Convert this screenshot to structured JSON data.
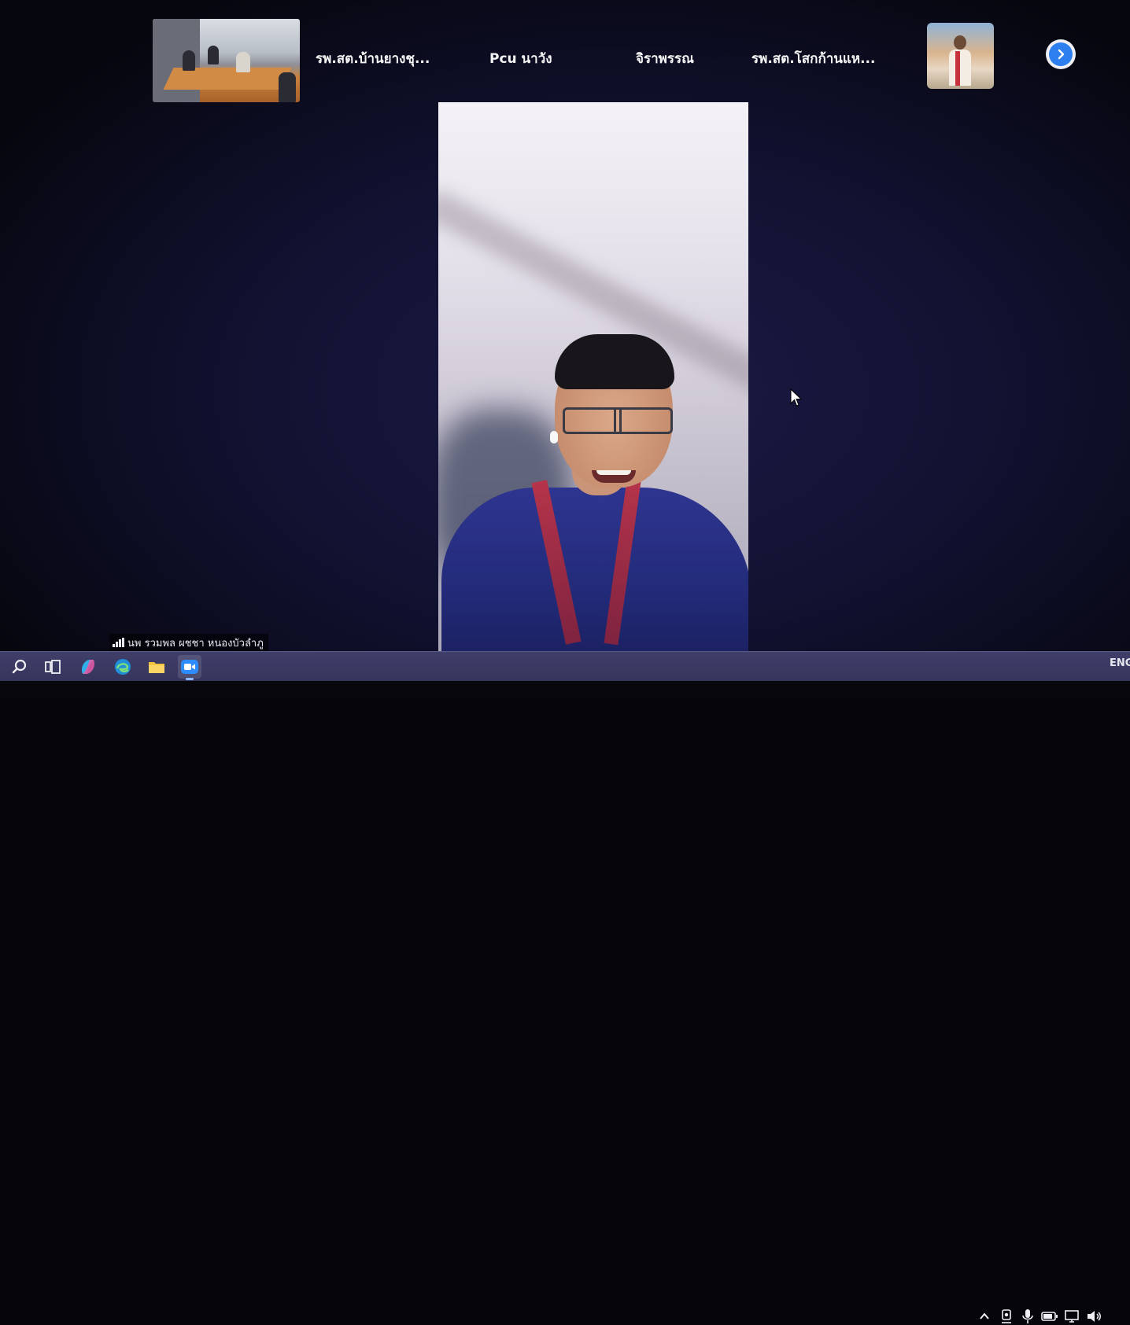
{
  "thumbnails": {
    "participants": [
      {
        "name": "รพ.สต.บ้านยางชุ..."
      },
      {
        "name": "Pcu นาวัง"
      },
      {
        "name": "จิราพรรณ"
      },
      {
        "name": "รพ.สต.โสกก้านแห..."
      }
    ],
    "next_icon": "chevron-right-icon"
  },
  "main_speaker": {
    "name": "นพ รวมพล ผชชา หนองบัวลำภู"
  },
  "taskbar": {
    "icons": [
      "search-icon",
      "task-view-icon",
      "copilot-icon",
      "edge-icon",
      "file-explorer-icon",
      "zoom-icon"
    ],
    "tray": {
      "language": "ENG",
      "icons": [
        "chevron-up-icon",
        "meet-now-icon",
        "microphone-icon",
        "battery-icon",
        "network-icon",
        "volume-icon"
      ]
    }
  },
  "colors": {
    "accent": "#2d7ff0",
    "taskbar": "#3a3a62",
    "background": "#06060e"
  }
}
